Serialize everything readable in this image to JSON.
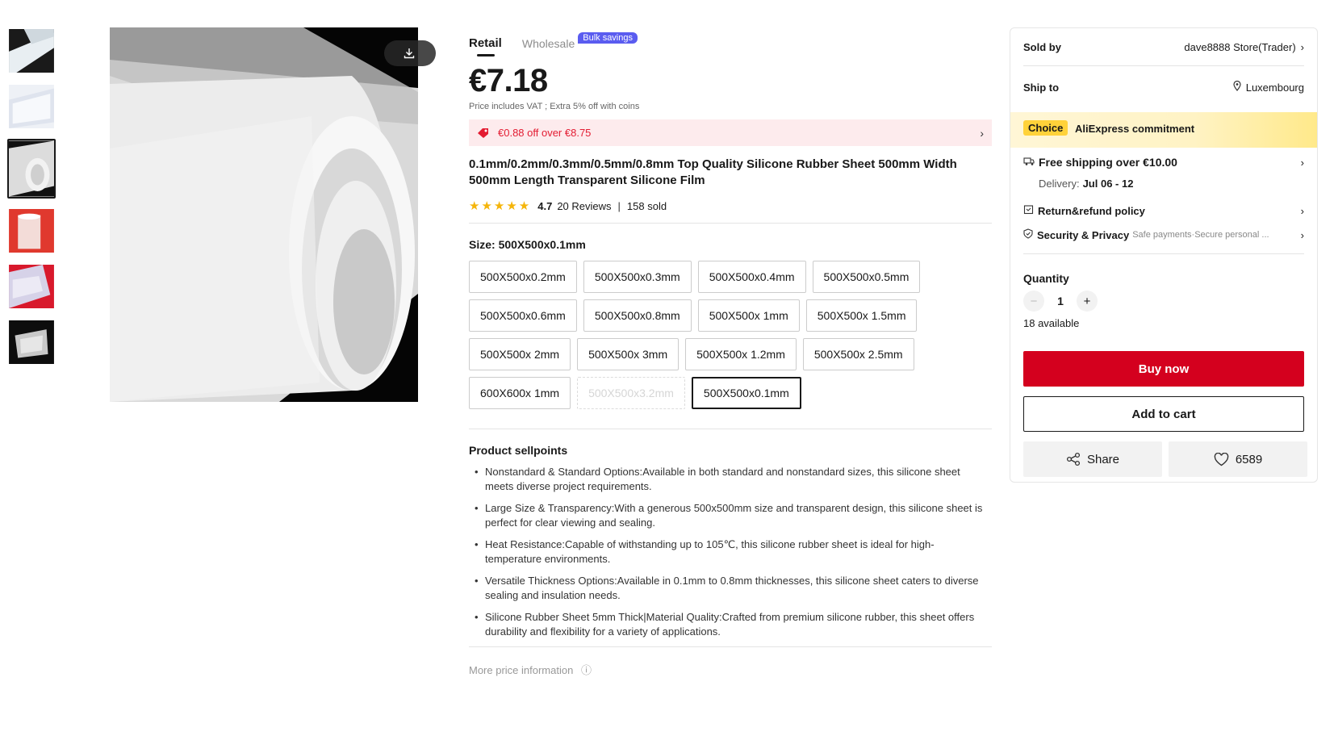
{
  "gallery": {
    "thumbnail_count": 6,
    "active_index": 2
  },
  "pricing_tabs": {
    "retail": "Retail",
    "wholesale": "Wholesale",
    "bulk_badge": "Bulk savings"
  },
  "price": "€7.18",
  "price_note": "Price includes VAT ; Extra 5% off with coins",
  "coupon": "€0.88 off over €8.75",
  "product_title": "0.1mm/0.2mm/0.3mm/0.5mm/0.8mm Top Quality Silicone Rubber Sheet 500mm Width 500mm Length Transparent Silicone Film",
  "rating": {
    "stars": 5,
    "score": "4.7",
    "reviews": "20 Reviews",
    "separator": "|",
    "sold": "158 sold"
  },
  "size": {
    "label": "Size: 500X500x0.1mm",
    "options": [
      {
        "label": "500X500x0.2mm",
        "state": "normal"
      },
      {
        "label": "500X500x0.3mm",
        "state": "normal"
      },
      {
        "label": "500X500x0.4mm",
        "state": "normal"
      },
      {
        "label": "500X500x0.5mm",
        "state": "normal"
      },
      {
        "label": "500X500x0.6mm",
        "state": "normal"
      },
      {
        "label": "500X500x0.8mm",
        "state": "normal"
      },
      {
        "label": "500X500x 1mm",
        "state": "normal"
      },
      {
        "label": "500X500x 1.5mm",
        "state": "normal"
      },
      {
        "label": "500X500x 2mm",
        "state": "normal"
      },
      {
        "label": "500X500x 3mm",
        "state": "normal"
      },
      {
        "label": "500X500x 1.2mm",
        "state": "normal"
      },
      {
        "label": "500X500x 2.5mm",
        "state": "normal"
      },
      {
        "label": "600X600x 1mm",
        "state": "normal"
      },
      {
        "label": "500X500x3.2mm",
        "state": "disabled"
      },
      {
        "label": "500X500x0.1mm",
        "state": "selected"
      }
    ]
  },
  "sellpoints": {
    "heading": "Product sellpoints",
    "items": [
      "Nonstandard & Standard Options:Available in both standard and nonstandard sizes, this silicone sheet meets diverse project requirements.",
      "Large Size & Transparency:With a generous 500x500mm size and transparent design, this silicone sheet is perfect for clear viewing and sealing.",
      "Heat Resistance:Capable of withstanding up to 105℃, this silicone rubber sheet is ideal for high-temperature environments.",
      "Versatile Thickness Options:Available in 0.1mm to 0.8mm thicknesses, this silicone sheet caters to diverse sealing and insulation needs.",
      "Silicone Rubber Sheet 5mm Thick|Material Quality:Crafted from premium silicone rubber, this sheet offers durability and flexibility for a variety of applications."
    ]
  },
  "more_price": "More price information",
  "panel": {
    "sold_by_label": "Sold by",
    "store": "dave8888 Store(Trader)",
    "ship_to_label": "Ship to",
    "ship_to": "Luxembourg",
    "choice_tag": "Choice",
    "commitment": "AliExpress commitment",
    "shipping": "Free shipping over €10.00",
    "delivery_label": "Delivery:",
    "delivery_dates": "Jul 06 - 12",
    "return_policy": "Return&refund policy",
    "security_label": "Security & Privacy",
    "security_detail": "Safe payments·Secure personal ...",
    "quantity_label": "Quantity",
    "quantity": "1",
    "available": "18 available",
    "buy_now": "Buy now",
    "add_to_cart": "Add to cart",
    "share": "Share",
    "wishlist_count": "6589"
  },
  "colors": {
    "accent_red": "#d4001e",
    "coupon_bg": "#fdebed",
    "bulk_badge": "#5a5cf0",
    "star": "#f5b50a",
    "choice_yellow": "#ffd23a"
  }
}
